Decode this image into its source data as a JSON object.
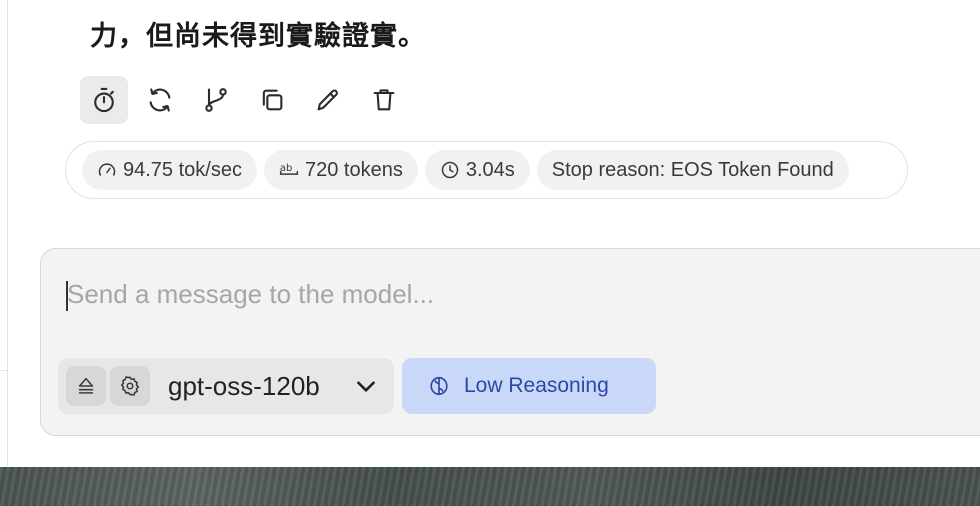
{
  "message": {
    "tail_text": "力，但尚未得到實驗證實。"
  },
  "message_actions": {
    "items": [
      {
        "name": "timer-icon",
        "active": true
      },
      {
        "name": "regenerate-icon",
        "active": false
      },
      {
        "name": "branch-icon",
        "active": false
      },
      {
        "name": "copy-icon",
        "active": false
      },
      {
        "name": "edit-icon",
        "active": false
      },
      {
        "name": "delete-icon",
        "active": false
      }
    ]
  },
  "stats": {
    "speed": "94.75 tok/sec",
    "tokens": "720 tokens",
    "duration": "3.04s",
    "stop_reason": "Stop reason: EOS Token Found"
  },
  "composer": {
    "placeholder": "Send a message to the model...",
    "model": "gpt-oss-120b",
    "reasoning": "Low Reasoning"
  },
  "colors": {
    "reasoning_bg": "#c9d8f8",
    "reasoning_text": "#2c47a6",
    "composer_bg": "#f3f3f3"
  }
}
